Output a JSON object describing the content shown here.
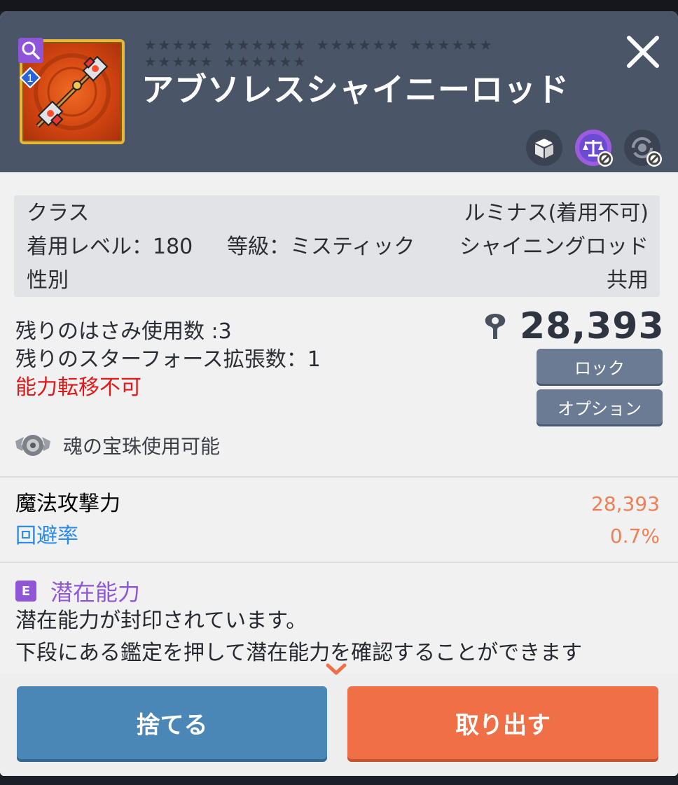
{
  "item": {
    "name": "アブソレスシャイニーロッド",
    "level_badge": "1",
    "star_rows": [
      [
        6,
        6,
        6,
        6
      ],
      [
        6,
        6
      ]
    ]
  },
  "info": {
    "class_label": "クラス",
    "class_value": "ルミナス(着用不可)",
    "level_label": "着用レベル：180",
    "grade_label": "等級：ミスティック",
    "type_value": "シャイニングロッド",
    "gender_label": "性別",
    "gender_value": "共用"
  },
  "status": {
    "scissors": "残りのはさみ使用数 :3",
    "starforce": "残りのスターフォース拡張数：1",
    "transfer": "能力転移不可",
    "combat_power": "28,393",
    "lock_label": "ロック",
    "option_label": "オプション",
    "soul_label": "魂の宝珠使用可能"
  },
  "stats": [
    {
      "label": "魔法攻撃力",
      "value": "28,393"
    },
    {
      "label": "回避率",
      "value": "0.7%"
    }
  ],
  "potential": {
    "badge": "E",
    "title": "潜在能力",
    "line1": "潜在能力が封印されています。",
    "line2": "下段にある鑑定を押して潜在能力を確認することができます"
  },
  "buttons": {
    "discard": "捨てる",
    "take_out": "取り出す"
  },
  "colors": {
    "header": "#4a5568",
    "accent_purple": "#8f57d6",
    "discard": "#4a86b6",
    "take_out": "#ef7046",
    "stat_value": "#ef7f55"
  },
  "icons": [
    "search-icon",
    "close-icon",
    "box-transfer-icon",
    "scale-blocked-icon",
    "refresh-blocked-icon",
    "combat-power-icon",
    "soul-orb-icon"
  ]
}
